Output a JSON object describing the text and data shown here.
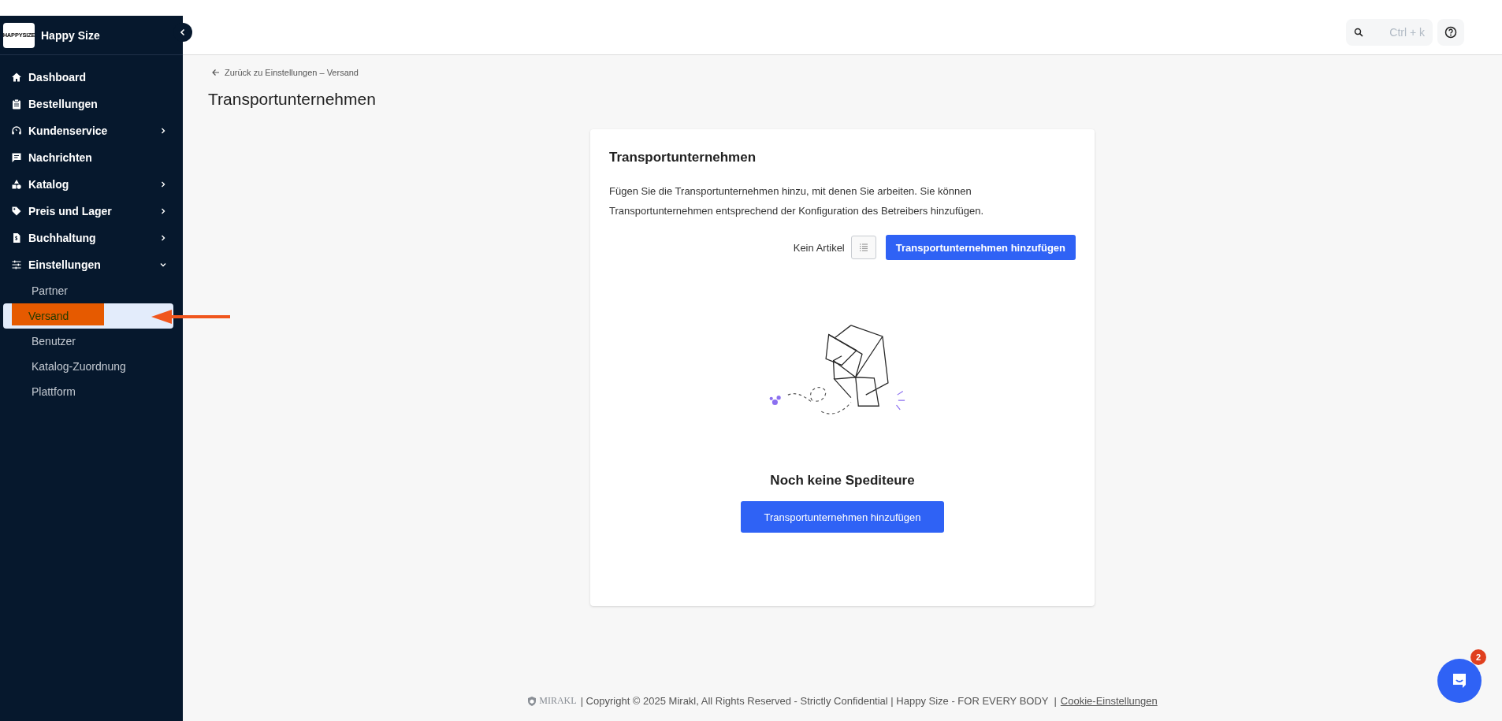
{
  "sidebar": {
    "logo_text": "HAPPYSIZE",
    "brand_name": "Happy Size",
    "items": [
      {
        "label": "Dashboard",
        "selected": false
      },
      {
        "label": "Bestellungen",
        "selected": false
      },
      {
        "label": "Kundenservice",
        "selected": false,
        "expanded": false
      },
      {
        "label": "Nachrichten",
        "selected": false
      },
      {
        "label": "Katalog",
        "selected": false,
        "expanded": false
      },
      {
        "label": "Preis und Lager",
        "selected": false,
        "expanded": false
      },
      {
        "label": "Buchhaltung",
        "selected": false,
        "expanded": false
      },
      {
        "label": "Einstellungen",
        "selected": false,
        "expanded": true,
        "children": [
          {
            "label": "Partner",
            "selected": false
          },
          {
            "label": "Versand",
            "selected": true
          },
          {
            "label": "Benutzer",
            "selected": false
          },
          {
            "label": "Katalog-Zuordnung",
            "selected": false
          },
          {
            "label": "Plattform",
            "selected": false
          }
        ]
      }
    ]
  },
  "header": {
    "search": {
      "placeholder": "Ctrl + k"
    }
  },
  "breadcrumb": "Zurück zu Einstellungen – Versand",
  "page_title": "Transportunternehmen",
  "card": {
    "title": "Transportunternehmen",
    "description": "Fügen Sie die Transportunternehmen hinzu, mit denen Sie arbeiten. Sie können Transportunternehmen entsprechend der Konfiguration des Betreibers hinzufügen.",
    "count_label": "Kein Artikel",
    "add_button": "Transportunternehmen hinzufügen",
    "empty_state": {
      "heading": "Noch keine Spediteure",
      "button": "Transportunternehmen hinzufügen"
    }
  },
  "footer": {
    "logo_text": "MIRAKL",
    "text": "| Copyright © 2025 Mirakl, All Rights Reserved - Strictly Confidential | Happy Size - FOR EVERY BODY  |",
    "link": "Cookie-Einstellungen"
  },
  "chat": {
    "badge": "2"
  }
}
